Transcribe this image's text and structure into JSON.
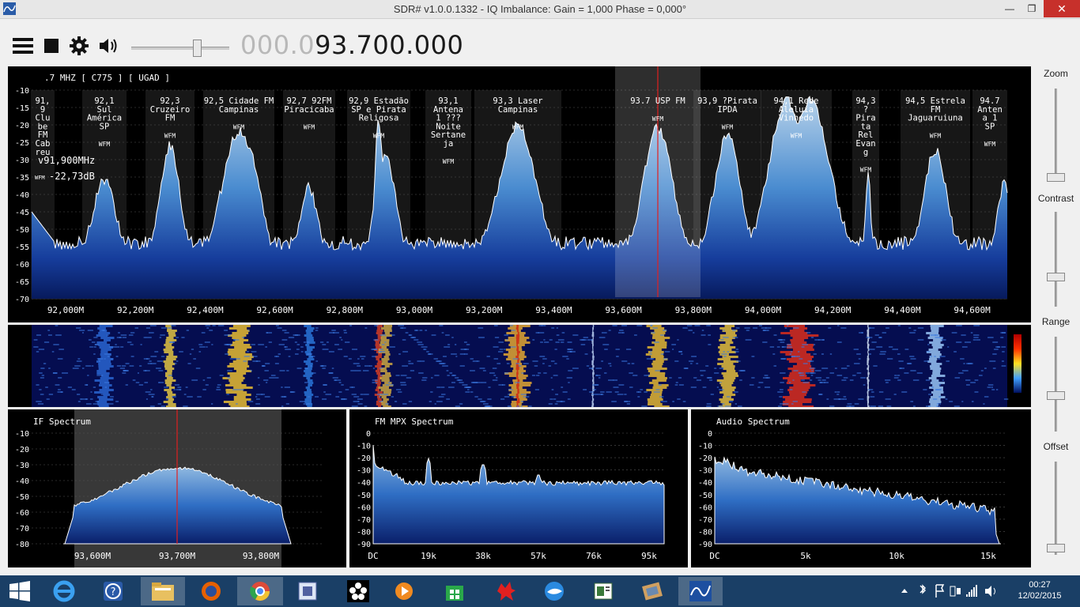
{
  "window": {
    "title": "SDR# v1.0.0.1332 - IQ Imbalance: Gain = 1,000 Phase = 0,000°"
  },
  "toolbar": {
    "freq_dim": "000.0",
    "freq_bright": "93.700.000"
  },
  "spectrum": {
    "header": ".7 MHZ [ C775 ]  [ UGAD ]",
    "cursor_freq": "v91,900MHz",
    "cursor_wfm": "WFM",
    "cursor_db": "-22,73dB",
    "y_ticks": [
      "-10",
      "-15",
      "-20",
      "-25",
      "-30",
      "-35",
      "-40",
      "-45",
      "-50",
      "-55",
      "-60",
      "-65",
      "-70"
    ],
    "x_ticks": [
      "92,000M",
      "92,200M",
      "92,400M",
      "92,600M",
      "92,800M",
      "93,000M",
      "93,200M",
      "93,400M",
      "93,600M",
      "93,800M",
      "94,000M",
      "94,200M",
      "94,400M",
      "94,600M"
    ],
    "stations": [
      {
        "lines": [
          "91,",
          "9",
          "Clu",
          "be",
          "FM",
          "Cab",
          "reu"
        ],
        "mode": ""
      },
      {
        "lines": [
          "92,1",
          "Sul",
          "América",
          "SP"
        ],
        "mode": "WFM"
      },
      {
        "lines": [
          "92,3",
          "Cruzeiro",
          "FM"
        ],
        "mode": "WFM"
      },
      {
        "lines": [
          "92,5 Cidade FM",
          "Campinas"
        ],
        "mode": "WFM"
      },
      {
        "lines": [
          "92,7 92FM",
          "Piracicaba"
        ],
        "mode": "WFM"
      },
      {
        "lines": [
          "92,9 Estadão",
          "SP e Pirata",
          "Religosa"
        ],
        "mode": "WFM"
      },
      {
        "lines": [
          "93,1",
          "Antena",
          "1 ???",
          "Noite",
          "Sertane",
          "ja"
        ],
        "mode": "WFM"
      },
      {
        "lines": [
          "93,3 Laser",
          "Campinas"
        ],
        "mode": "WFM"
      },
      {
        "lines": [
          "93.7 USP FM"
        ],
        "mode": "WFM"
      },
      {
        "lines": [
          "93,9 ?Pirata",
          "IPDA"
        ],
        "mode": "WFM"
      },
      {
        "lines": [
          "94,1 Rede",
          "Aleluia",
          "Vinhedo"
        ],
        "mode": "WFM"
      },
      {
        "lines": [
          "94,3",
          "?",
          "Pira",
          "ta",
          "Rel",
          "Evan",
          "g"
        ],
        "mode": "WFM"
      },
      {
        "lines": [
          "94,5 Estrela",
          "FM",
          "Jaguaruiuna"
        ],
        "mode": "WFM"
      },
      {
        "lines": [
          "94.7",
          "Anten",
          "a 1",
          "SP"
        ],
        "mode": "WFM"
      }
    ]
  },
  "if_spectrum": {
    "title": "IF Spectrum",
    "y_ticks": [
      "-10",
      "-20",
      "-30",
      "-40",
      "-50",
      "-60",
      "-70",
      "-80"
    ],
    "x_ticks": [
      "93,600M",
      "93,700M",
      "93,800M"
    ]
  },
  "mpx_spectrum": {
    "title": "FM MPX Spectrum",
    "y_ticks": [
      "0",
      "-10",
      "-20",
      "-30",
      "-40",
      "-50",
      "-60",
      "-70",
      "-80",
      "-90"
    ],
    "x_ticks": [
      "DC",
      "19k",
      "38k",
      "57k",
      "76k",
      "95k"
    ]
  },
  "audio_spectrum": {
    "title": "Audio Spectrum",
    "y_ticks": [
      "0",
      "-10",
      "-20",
      "-30",
      "-40",
      "-50",
      "-60",
      "-70",
      "-80",
      "-90"
    ],
    "x_ticks": [
      "DC",
      "5k",
      "10k",
      "15k"
    ]
  },
  "sidebar": {
    "zoom": "Zoom",
    "contrast": "Contrast",
    "range": "Range",
    "offset": "Offset"
  },
  "taskbar": {
    "time": "00:27",
    "date": "12/02/2015"
  }
}
